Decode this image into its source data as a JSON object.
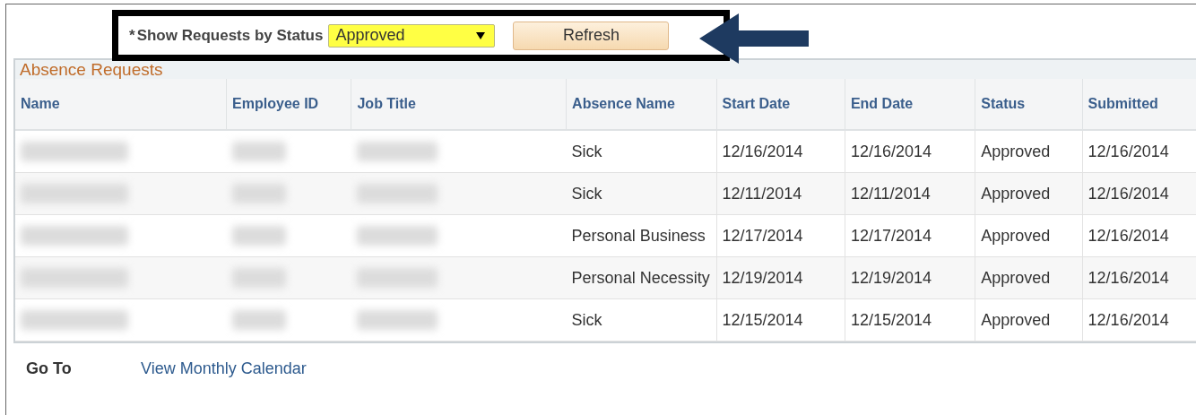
{
  "filter": {
    "required_mark": "*",
    "label": "Show Requests by Status",
    "status": "Approved",
    "button": "Refresh"
  },
  "table": {
    "title": "Absence Requests",
    "columns": [
      "Name",
      "Employee ID",
      "Job Title",
      "Absence Name",
      "Start Date",
      "End Date",
      "Status",
      "Submitted"
    ],
    "rows": [
      {
        "absence_name": "Sick",
        "start_date": "12/16/2014",
        "end_date": "12/16/2014",
        "status": "Approved",
        "submitted": "12/16/2014"
      },
      {
        "absence_name": "Sick",
        "start_date": "12/11/2014",
        "end_date": "12/11/2014",
        "status": "Approved",
        "submitted": "12/16/2014"
      },
      {
        "absence_name": "Personal Business",
        "start_date": "12/17/2014",
        "end_date": "12/17/2014",
        "status": "Approved",
        "submitted": "12/16/2014"
      },
      {
        "absence_name": "Personal Necessity",
        "start_date": "12/19/2014",
        "end_date": "12/19/2014",
        "status": "Approved",
        "submitted": "12/16/2014"
      },
      {
        "absence_name": "Sick",
        "start_date": "12/15/2014",
        "end_date": "12/15/2014",
        "status": "Approved",
        "submitted": "12/16/2014"
      }
    ]
  },
  "go_to": {
    "label": "Go To",
    "link": "View Monthly Calendar"
  }
}
